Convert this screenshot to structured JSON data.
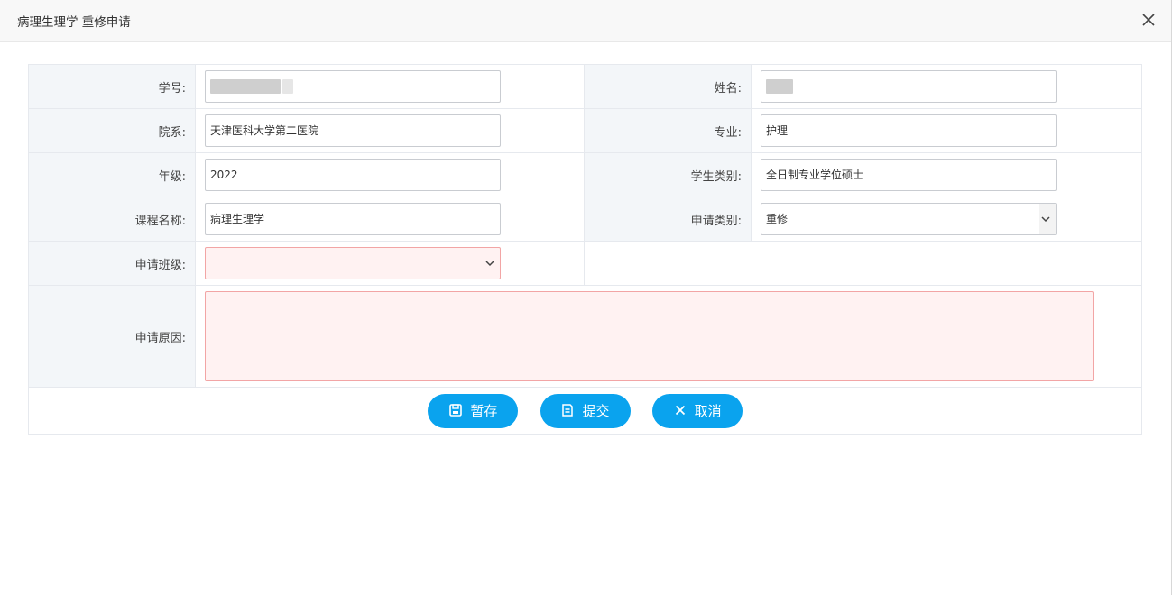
{
  "dialog": {
    "title": "病理生理学 重修申请",
    "close_icon": "close-icon"
  },
  "form": {
    "student_id": {
      "label": "学号:",
      "value": ""
    },
    "name": {
      "label": "姓名:",
      "value": ""
    },
    "department": {
      "label": "院系:",
      "value": "天津医科大学第二医院"
    },
    "major": {
      "label": "专业:",
      "value": "护理"
    },
    "grade": {
      "label": "年级:",
      "value": "2022"
    },
    "student_type": {
      "label": "学生类别:",
      "value": "全日制专业学位硕士"
    },
    "course_name": {
      "label": "课程名称:",
      "value": "病理生理学"
    },
    "apply_type": {
      "label": "申请类别:",
      "value": "重修"
    },
    "apply_class": {
      "label": "申请班级:",
      "value": ""
    },
    "reason": {
      "label": "申请原因:",
      "value": ""
    }
  },
  "buttons": {
    "save": {
      "label": "暂存",
      "icon": "save-icon"
    },
    "submit": {
      "label": "提交",
      "icon": "document-icon"
    },
    "cancel": {
      "label": "取消",
      "icon": "close-icon"
    }
  },
  "colors": {
    "accent": "#0aa3ee",
    "label_bg": "#f3f6f9",
    "invalid_bg": "#fff2f2",
    "invalid_border": "#f2a5a5"
  }
}
